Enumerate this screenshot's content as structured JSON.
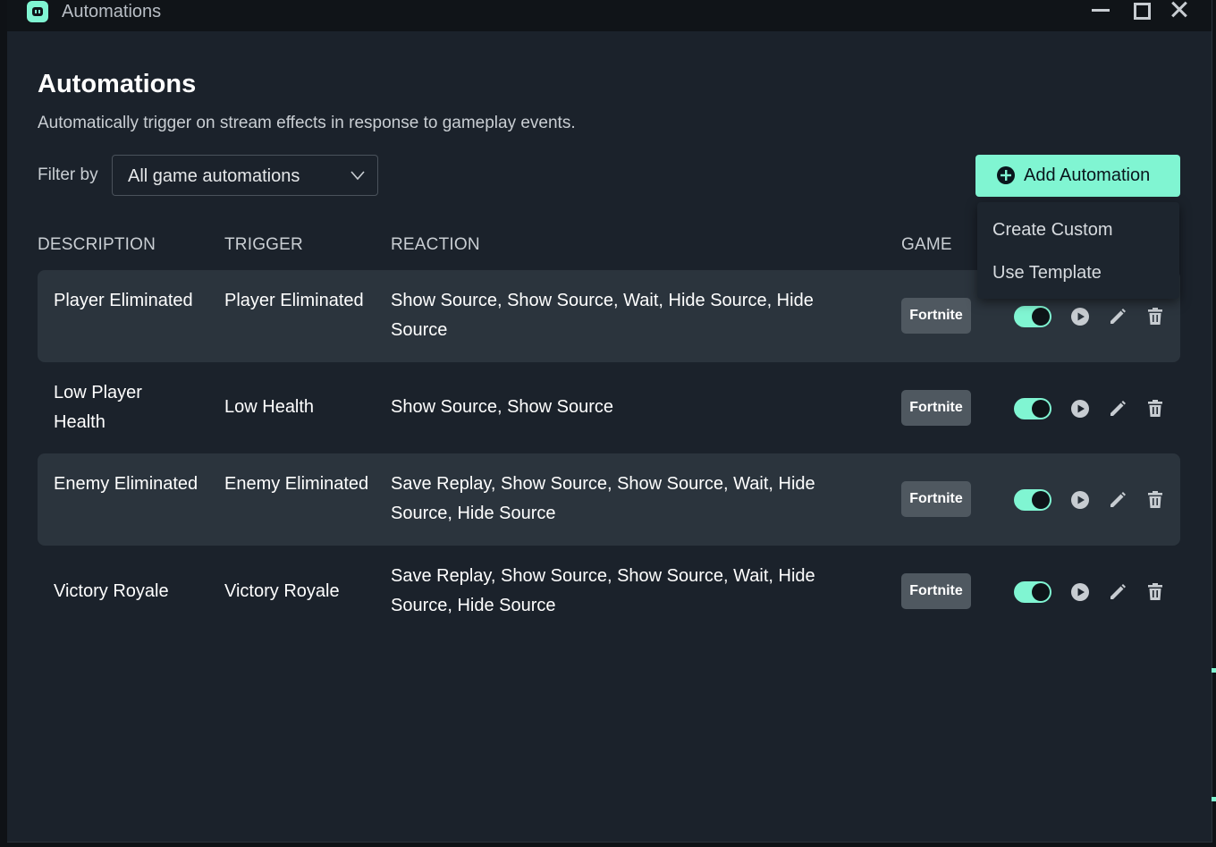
{
  "window": {
    "title": "Automations"
  },
  "page": {
    "title": "Automations",
    "subtitle": "Automatically trigger on stream effects in response to gameplay events."
  },
  "filter": {
    "label": "Filter by",
    "selected": "All game automations"
  },
  "add_button": {
    "label": "Add Automation"
  },
  "add_menu": {
    "items": [
      "Create Custom",
      "Use Template"
    ]
  },
  "table": {
    "headers": {
      "description": "DESCRIPTION",
      "trigger": "TRIGGER",
      "reaction": "REACTION",
      "game": "GAME"
    },
    "rows": [
      {
        "description": "Player Eliminated",
        "trigger": "Player Eliminated",
        "reaction": "Show Source, Show Source, Wait, Hide Source, Hide Source",
        "game": "Fortnite",
        "enabled": true
      },
      {
        "description": "Low Player Health",
        "trigger": "Low Health",
        "reaction": "Show Source, Show Source",
        "game": "Fortnite",
        "enabled": true
      },
      {
        "description": "Enemy Eliminated",
        "trigger": "Enemy Eliminated",
        "reaction": "Save Replay, Show Source, Show Source, Wait, Hide Source, Hide Source",
        "game": "Fortnite",
        "enabled": true
      },
      {
        "description": "Victory Royale",
        "trigger": "Victory Royale",
        "reaction": "Save Replay, Show Source, Show Source, Wait, Hide Source, Hide Source",
        "game": "Fortnite",
        "enabled": true
      }
    ]
  },
  "colors": {
    "accent": "#80f5d2",
    "background": "#1b222b",
    "row_shade": "#2b343d",
    "badge": "#4f5860"
  }
}
